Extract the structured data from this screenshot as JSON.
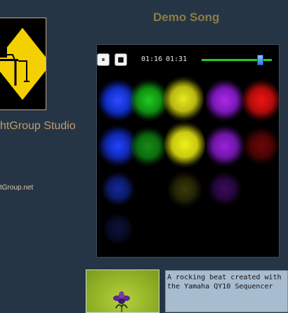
{
  "sidebar": {
    "studio_name": "htGroup Studio",
    "studio_site": "tGroup.net"
  },
  "song": {
    "title": "Demo Song",
    "description": "A rocking beat created with the Yamaha QY10 Sequencer"
  },
  "player": {
    "pause_label": "⏸",
    "stop_label": "■",
    "elapsed": "01:16",
    "total": "01:31",
    "progress_fraction": 0.83,
    "colors": {
      "blue": "#2244ff",
      "green": "#22bb22",
      "yellow": "#dddd11",
      "purple": "#9922dd",
      "red": "#dd1111",
      "progress": "#22cc22"
    }
  }
}
